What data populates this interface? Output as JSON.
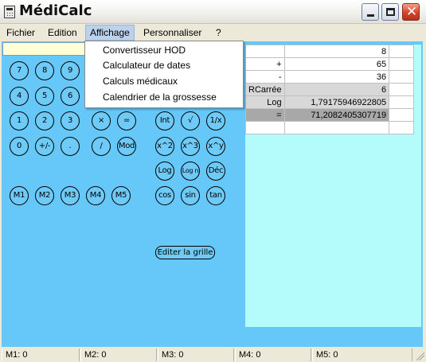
{
  "window": {
    "title": "MédiCalc"
  },
  "menu": {
    "items": [
      "Fichier",
      "Edition",
      "Affichage",
      "Personnaliser",
      "?"
    ],
    "active": "Affichage"
  },
  "dropdown": {
    "items": [
      "Convertisseur HOD",
      "Calculateur de dates",
      "Calculs médicaux",
      "Calendrier de la grossesse"
    ]
  },
  "keypad": {
    "digits": [
      "7",
      "8",
      "9",
      "4",
      "5",
      "6",
      "1",
      "2",
      "3",
      "0",
      "+/-",
      "."
    ],
    "operators": [
      "×",
      "=",
      "/",
      "Mod"
    ],
    "functions": [
      "Int",
      "√",
      "1/x",
      "x^2",
      "x^3",
      "x^y",
      "Log",
      "Log n",
      "Déc",
      "cos",
      "sin",
      "tan"
    ],
    "memory": [
      "M1",
      "M2",
      "M3",
      "M4",
      "M5"
    ],
    "edit_grid_label": "Editer la grille"
  },
  "grid": {
    "rows": [
      {
        "op": "",
        "value": "8"
      },
      {
        "op": "+",
        "value": "65"
      },
      {
        "op": "-",
        "value": "36"
      },
      {
        "op": "RCarrée",
        "value": "6"
      },
      {
        "op": "Log",
        "value": "1,79175946922805"
      },
      {
        "op": "=",
        "value": "71,2082405307719"
      },
      {
        "op": "",
        "value": ""
      }
    ]
  },
  "status": [
    "M1: 0",
    "M2: 0",
    "M3: 0",
    "M4: 0",
    "M5: 0"
  ],
  "colors": {
    "background": "#65c8f8",
    "grid_background": "#b4fbfb",
    "display": "#ffffd6"
  }
}
